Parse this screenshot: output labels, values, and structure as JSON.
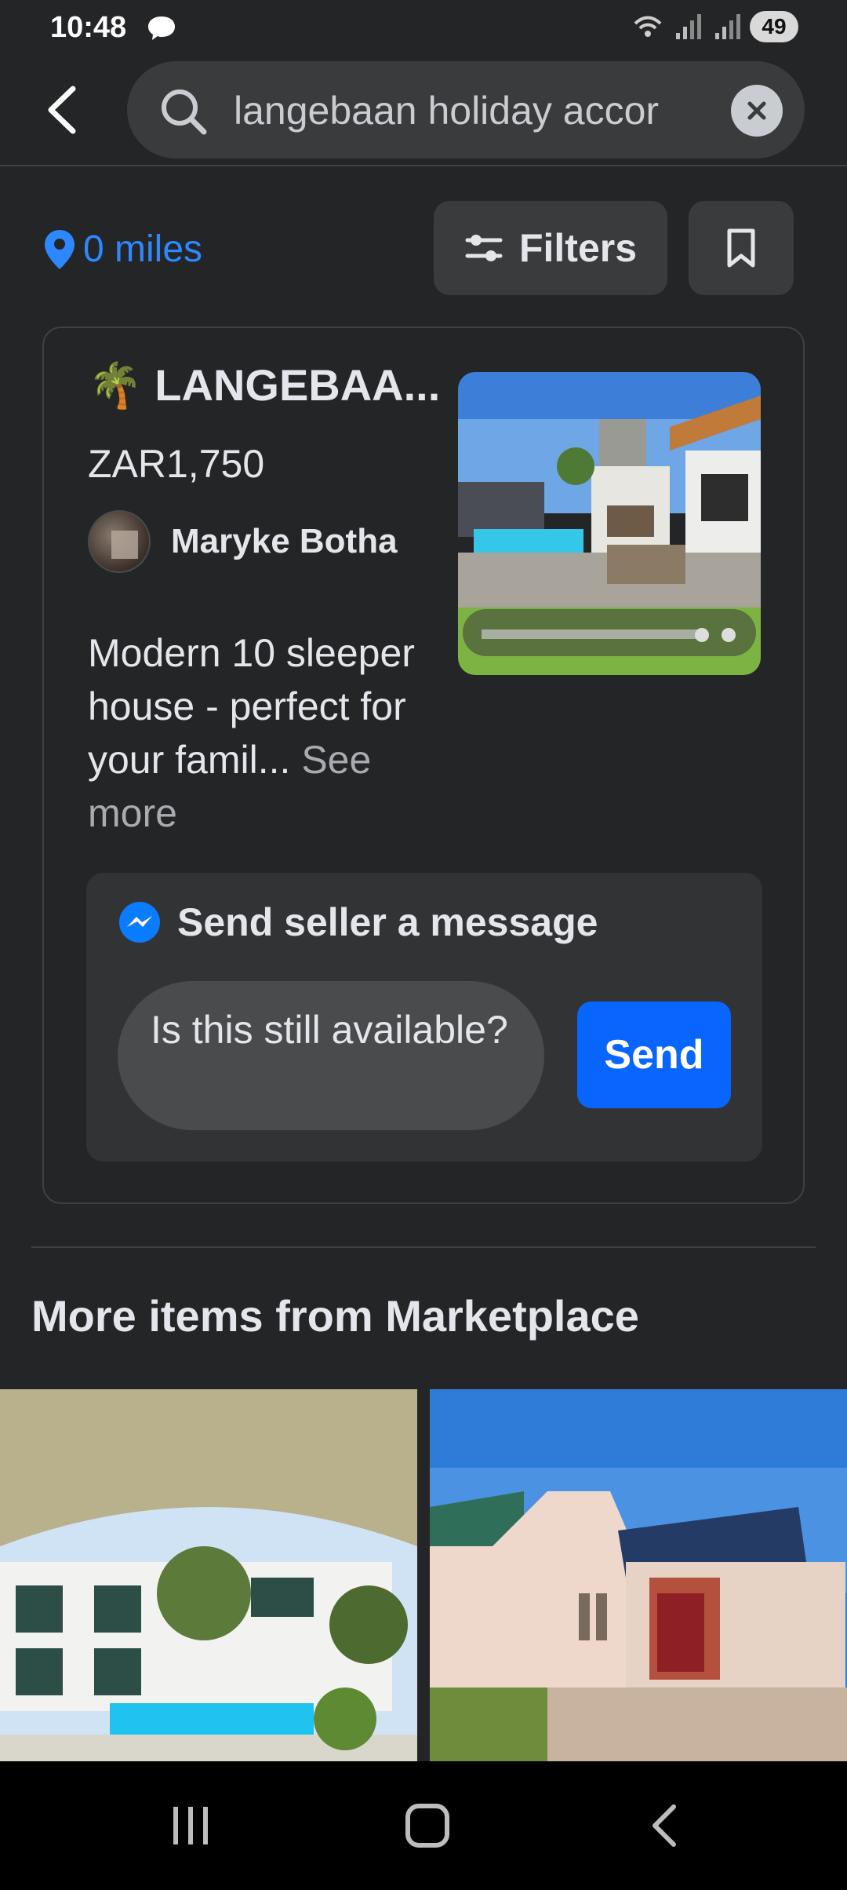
{
  "status_bar": {
    "time": "10:48",
    "battery": "49",
    "icons": [
      "chat-bubble-icon",
      "wifi-icon",
      "signal-icon",
      "signal-icon"
    ]
  },
  "header": {
    "search_value": "langebaan holiday accor",
    "icons": [
      "back-arrow-icon",
      "search-icon",
      "clear-icon"
    ]
  },
  "filter_row": {
    "location": "0 miles",
    "filters_label": "Filters",
    "icons": [
      "location-pin-icon",
      "sliders-icon",
      "bookmark-icon"
    ]
  },
  "listing": {
    "title_emoji": "🌴",
    "title": "LANGEBAA...",
    "price": "ZAR1,750",
    "seller_name": "Maryke Botha",
    "description": "Modern 10 sleeper house - perfect for your famil...",
    "see_more": "See more"
  },
  "message": {
    "title": "Send seller a message",
    "input_value": "Is this still available?",
    "send_label": "Send",
    "icons": [
      "messenger-icon"
    ]
  },
  "more_section": {
    "title": "More items from Marketplace"
  },
  "colors": {
    "background": "#242527",
    "accent": "#0866ff",
    "link_blue": "#2d88ff",
    "surface": "#3a3b3c"
  },
  "nav_bar": {
    "icons": [
      "recent-apps-icon",
      "home-icon",
      "back-icon"
    ]
  }
}
